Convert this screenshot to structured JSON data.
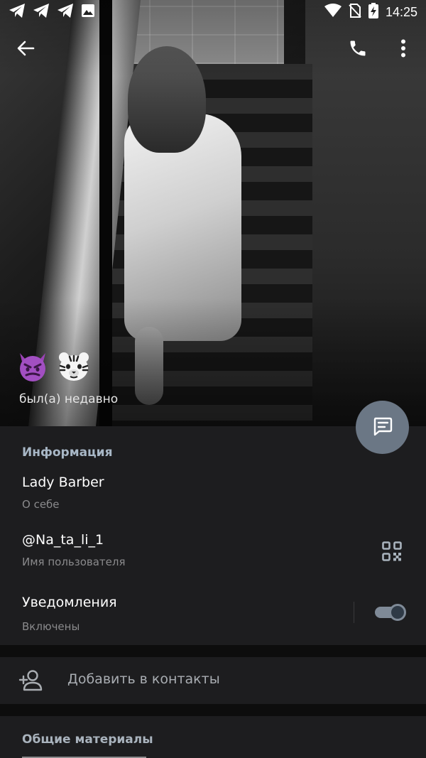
{
  "status_bar": {
    "time": "14:25",
    "icons": [
      "telegram-icon",
      "telegram-icon",
      "telegram-icon",
      "image-icon",
      "wifi-icon",
      "no-sim-icon",
      "battery-charging-icon"
    ]
  },
  "top_bar": {
    "icons": [
      "back-arrow-icon",
      "phone-icon",
      "more-vert-icon"
    ]
  },
  "profile": {
    "name_emoji": [
      "smiling-imp-emoji",
      "tiger-face-emoji"
    ],
    "last_seen": "был(а) недавно"
  },
  "info": {
    "section_title": "Информация",
    "bio": {
      "value": "Lady Barber",
      "caption": "О себе"
    },
    "username": {
      "value": "@Na_ta_li_1",
      "caption": "Имя пользователя"
    },
    "notifications": {
      "label": "Уведомления",
      "caption": "Включены",
      "enabled": true
    }
  },
  "actions": {
    "add_contact": "Добавить в контакты"
  },
  "shared": {
    "section_title": "Общие материалы"
  },
  "colors": {
    "accent": "#a8b7c6",
    "card_bg": "#1d1d1f",
    "fab_bg": "#6b7785",
    "caption": "#8a8a8c"
  }
}
